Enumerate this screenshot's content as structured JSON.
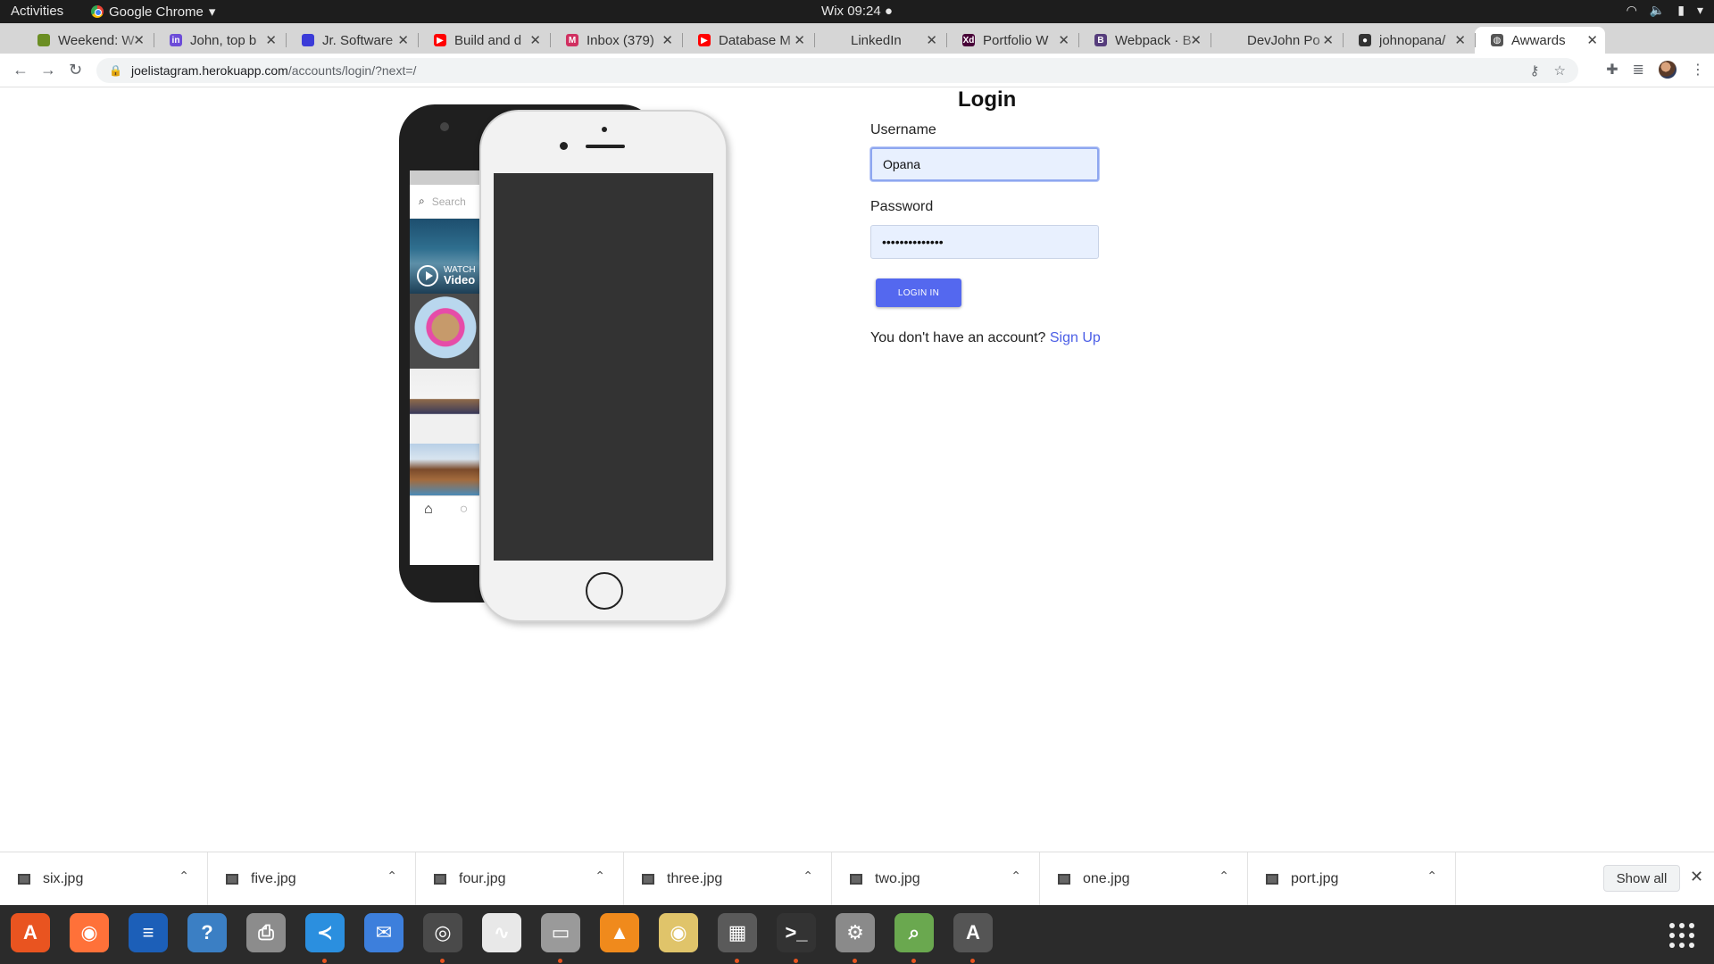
{
  "topbar": {
    "activities": "Activities",
    "app_name": "Google Chrome",
    "clock": "Wix 09:24 ●"
  },
  "tabs": [
    {
      "title": "Weekend: W",
      "color": "#6b8e23",
      "glyph": ""
    },
    {
      "title": "John, top b",
      "color": "#6c4cd8",
      "glyph": "in"
    },
    {
      "title": "Jr. Software",
      "color": "#3b3bd8",
      "glyph": ""
    },
    {
      "title": "Build and d",
      "color": "#ff0000",
      "glyph": "▶"
    },
    {
      "title": "Inbox (379)",
      "color": "#d03060",
      "glyph": "M"
    },
    {
      "title": "Database M",
      "color": "#ff0000",
      "glyph": "▶"
    },
    {
      "title": "LinkedIn",
      "color": "#d6d6d6",
      "glyph": ""
    },
    {
      "title": "Portfolio W",
      "color": "#470137",
      "glyph": "Xd"
    },
    {
      "title": "Webpack · B",
      "color": "#563d7c",
      "glyph": "B"
    },
    {
      "title": "DevJohn Po",
      "color": "#d6d6d6",
      "glyph": ""
    },
    {
      "title": "johnopana/",
      "color": "#333333",
      "glyph": "●"
    },
    {
      "title": "Awwards",
      "color": "#555555",
      "glyph": "◍"
    }
  ],
  "url": {
    "host": "joelistagram.herokuapp.com",
    "path": "/accounts/login/?next=/"
  },
  "phone": {
    "search_placeholder": "Search",
    "watch_label": "WATCH",
    "video_label": "Video"
  },
  "login": {
    "title": "Login",
    "username_label": "Username",
    "username_value": "Opana",
    "password_label": "Password",
    "password_value": "••••••••••••••",
    "button_label": "Login In",
    "signup_prompt": "You don't have an account?",
    "signup_link": "Sign Up"
  },
  "downloads": [
    {
      "name": "six.jpg"
    },
    {
      "name": "five.jpg"
    },
    {
      "name": "four.jpg"
    },
    {
      "name": "three.jpg"
    },
    {
      "name": "two.jpg"
    },
    {
      "name": "one.jpg"
    },
    {
      "name": "port.jpg"
    }
  ],
  "shelf": {
    "show_all": "Show all"
  },
  "dock": [
    {
      "name": "software-center-icon",
      "color": "#e95420",
      "glyph": "A",
      "running": false
    },
    {
      "name": "firefox-icon",
      "color": "#ff7139",
      "glyph": "◉",
      "running": false
    },
    {
      "name": "writer-icon",
      "color": "#1c5fb8",
      "glyph": "≡",
      "running": false
    },
    {
      "name": "help-icon",
      "color": "#3b7fc4",
      "glyph": "?",
      "running": false
    },
    {
      "name": "printer-icon",
      "color": "#8c8c8c",
      "glyph": "⎙",
      "running": false
    },
    {
      "name": "vscode-icon",
      "color": "#2b8fdf",
      "glyph": "≺",
      "running": true
    },
    {
      "name": "thunderbird-icon",
      "color": "#3d7fdc",
      "glyph": "✉",
      "running": false
    },
    {
      "name": "chrome-icon",
      "color": "#4a4a4a",
      "glyph": "◎",
      "running": true
    },
    {
      "name": "evince-icon",
      "color": "#e8e8e8",
      "glyph": "∿",
      "running": false
    },
    {
      "name": "files-icon",
      "color": "#9a9a9a",
      "glyph": "▭",
      "running": true
    },
    {
      "name": "vlc-icon",
      "color": "#f08a1c",
      "glyph": "▲",
      "running": false
    },
    {
      "name": "rhythmbox-icon",
      "color": "#e0c46a",
      "glyph": "◉",
      "running": false
    },
    {
      "name": "video-editor-icon",
      "color": "#5a5a5a",
      "glyph": "▦",
      "running": true
    },
    {
      "name": "terminal-icon",
      "color": "#333333",
      "glyph": ">_",
      "running": true
    },
    {
      "name": "settings-icon",
      "color": "#8a8a8a",
      "glyph": "⚙",
      "running": true
    },
    {
      "name": "image-viewer-icon",
      "color": "#6aa84f",
      "glyph": "⌕",
      "running": true
    },
    {
      "name": "updater-icon",
      "color": "#555555",
      "glyph": "A",
      "running": true
    }
  ]
}
